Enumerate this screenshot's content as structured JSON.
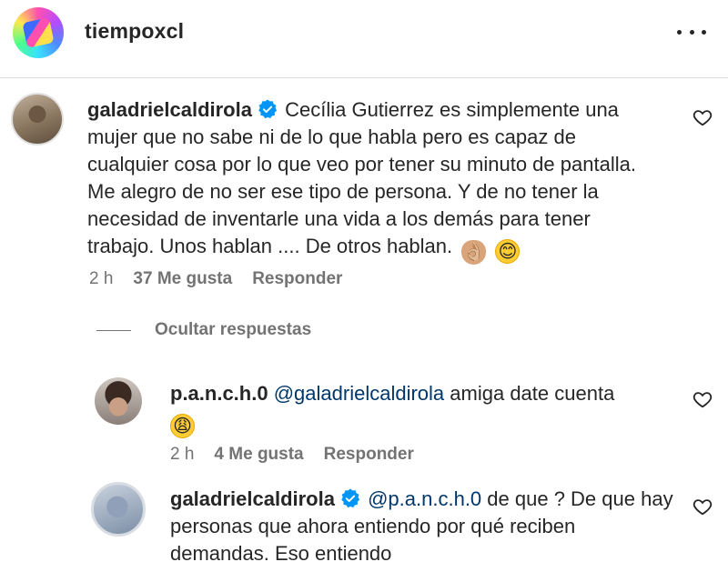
{
  "header": {
    "username": "tiempoxcl"
  },
  "comment": {
    "username": "galadrielcaldirola",
    "text": "Cecília Gutierrez es simplemente una mujer que no sabe ni de lo que habla pero es capaz de cualquier cosa por lo que veo por tener su minuto de pantalla. Me alegro de no ser ese tipo de persona. Y de no tener la necesidad de inventarle una vida a los demás para tener trabajo. Unos hablan .... De otros hablan.",
    "emojis": [
      "👌🏼",
      "😊"
    ],
    "time": "2 h",
    "likes": "37 Me gusta",
    "reply_label": "Responder"
  },
  "hide_replies_label": "Ocultar respuestas",
  "replies": [
    {
      "username": "p.a.n.c.h.0",
      "mention": "@galadrielcaldirola",
      "text": "amiga date cuenta",
      "emoji": "😩",
      "time": "2 h",
      "likes": "4 Me gusta",
      "reply_label": "Responder"
    },
    {
      "username": "galadrielcaldirola",
      "mention": "@p.a.n.c.h.0",
      "text": "de que ? De que hay personas que ahora entiendo por qué reciben demandas. Eso entiendo"
    }
  ],
  "colors": {
    "text": "#262626",
    "secondary": "#737373",
    "mention": "#00376b",
    "verified": "#0095f6"
  }
}
